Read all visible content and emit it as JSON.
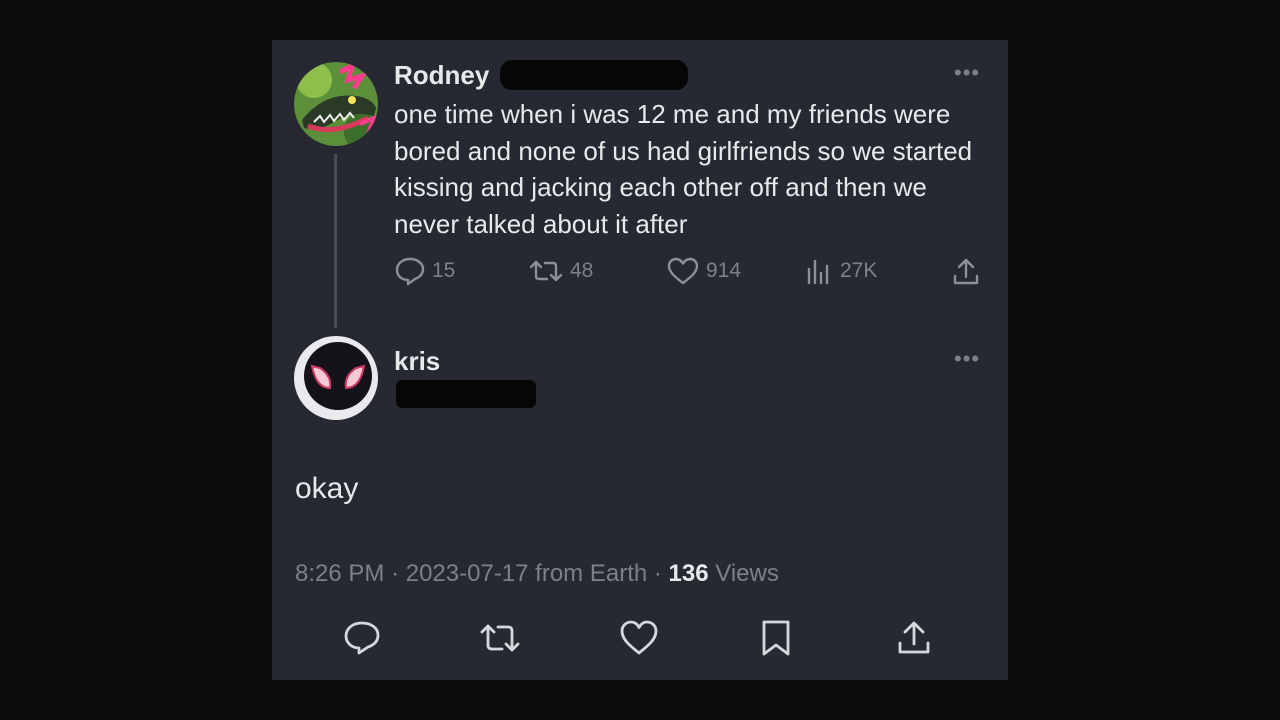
{
  "original_tweet": {
    "author_name": "Rodney",
    "text": "one time when i was 12 me and my friends were bored and none of us had girlfriends so we started kissing and jacking each other off and then we never talked about it after",
    "more_icon": "more-horizontal-icon",
    "stats": {
      "replies": "15",
      "retweets": "48",
      "likes": "914",
      "views": "27K"
    }
  },
  "reply_tweet": {
    "author_name": "kris",
    "text": "okay",
    "more_icon": "more-horizontal-icon",
    "meta": {
      "time": "8:26 PM",
      "date": "2023-07-17",
      "source": "from Earth",
      "views_count": "136",
      "views_label": "Views"
    }
  },
  "colors": {
    "background": "#0b0b0b",
    "card": "#262932",
    "text": "#e7e9ea",
    "muted": "#7b8189"
  }
}
